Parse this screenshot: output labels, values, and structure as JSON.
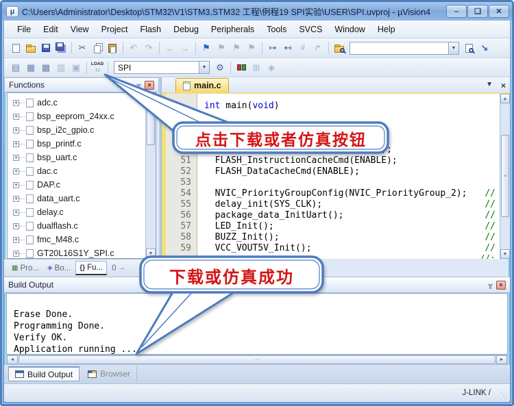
{
  "window": {
    "title": "C:\\Users\\Administrator\\Desktop\\STM32\\V1\\STM3,STM32 工程\\例程19 SPI实验\\USER\\SPI.uvproj - µVision4",
    "minimize": "–",
    "maximize": "❑",
    "close": "✕"
  },
  "menu": {
    "items": [
      "File",
      "Edit",
      "View",
      "Project",
      "Flash",
      "Debug",
      "Peripherals",
      "Tools",
      "SVCS",
      "Window",
      "Help"
    ]
  },
  "toolbar": {
    "search_value": "",
    "load_label": "LOAD",
    "load_arrows": "↓↓",
    "target": "SPI"
  },
  "icons": {
    "cut": "✂",
    "undo": "↶",
    "redo": "↷",
    "back": "←",
    "forward": "→",
    "flag": "⚑",
    "indent": "↦",
    "outdent": "↤",
    "comment": "//",
    "uncomment": "/*",
    "arrow_se": "↘",
    "translate": "▤",
    "build": "▦",
    "rebuild": "▩",
    "batch": "▥",
    "stop": "▣",
    "gear": "⚙",
    "grid": "⊞",
    "diamond": "◈",
    "pin": "╥",
    "close_x": "×",
    "dropdown": "▼",
    "up": "▲",
    "down": "▼",
    "left": "◄",
    "right": "►",
    "plus": "+",
    "grip": "≡",
    "hgrip": "⋯",
    "braces": "{}",
    "resize_grip": "⋱"
  },
  "sidebar": {
    "title": "Functions",
    "files": [
      "adc.c",
      "bsp_eeprom_24xx.c",
      "bsp_i2c_gpio.c",
      "bsp_printf.c",
      "bsp_uart.c",
      "dac.c",
      "DAP.c",
      "data_uart.c",
      "delay.c",
      "dualflash.c",
      "fmc_M48.c",
      "GT20L16S1Y_SPI.c"
    ],
    "tabs": {
      "projects": "Pro...",
      "books": "Bo...",
      "functions": "Fu...",
      "templates": "0"
    }
  },
  "editor": {
    "tab": "main.c",
    "main_line": {
      "kw1": "int",
      "mid": " main(",
      "kw2": "void",
      "close": ")"
    },
    "lines": [
      {
        "num": "",
        "code": "",
        "comment": ""
      },
      {
        "num": "",
        "code": "",
        "comment": ""
      },
      {
        "num": "",
        "code": "",
        "comment": ""
      },
      {
        "num": "",
        "code": "",
        "comment": ""
      },
      {
        "num": "",
        "code": "                                 );",
        "comment": ""
      },
      {
        "num": "51",
        "code": "  FLASH_InstructionCacheCmd(ENABLE);",
        "comment": ""
      },
      {
        "num": "52",
        "code": "  FLASH_DataCacheCmd(ENABLE);",
        "comment": ""
      },
      {
        "num": "53",
        "code": "",
        "comment": ""
      },
      {
        "num": "54",
        "code": "  NVIC_PriorityGroupConfig(NVIC_PriorityGroup_2);",
        "comment": "//"
      },
      {
        "num": "55",
        "code": "  delay_init(SYS_CLK);",
        "comment": "//"
      },
      {
        "num": "56",
        "code": "  package_data_InitUart();",
        "comment": "//"
      },
      {
        "num": "57",
        "code": "  LED_Init();",
        "comment": "//"
      },
      {
        "num": "58",
        "code": "  BUZZ_Init();",
        "comment": "//"
      },
      {
        "num": "59",
        "code": "  VCC_VOUT5V_Init();",
        "comment": "//"
      },
      {
        "num": "",
        "code": "",
        "comment": "//:"
      }
    ]
  },
  "callouts": {
    "tip1": "点击下载或者仿真按钮",
    "tip2": "下载或仿真成功",
    "border_color": "#4c7cc0",
    "text_color": "#d41414"
  },
  "output": {
    "title": "Build Output",
    "lines": [
      "Erase Done.",
      "Programming Done.",
      "Verify OK.",
      "Application running ..."
    ]
  },
  "bottom_tabs": {
    "build_output": "Build Output",
    "browser": "Browser"
  },
  "statusbar": {
    "right": "J-LINK /"
  }
}
